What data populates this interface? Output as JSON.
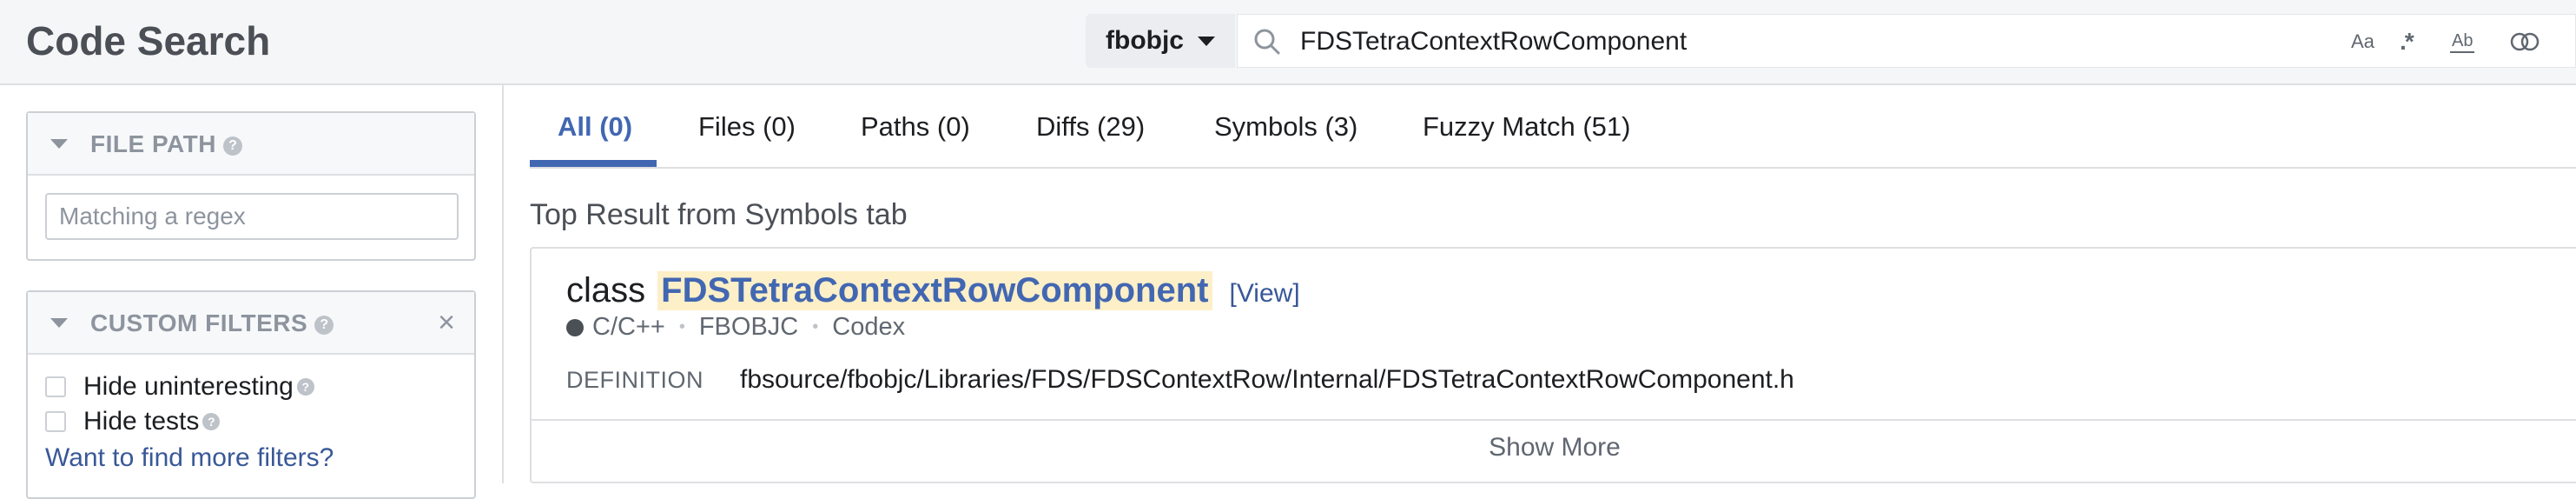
{
  "header": {
    "title": "Code Search",
    "repo": "fbobjc",
    "query": "FDSTetraContextRowComponent",
    "options": {
      "case": "Aa",
      "regex": ".*",
      "whole_word": "Ab",
      "link": ""
    }
  },
  "sidebar": {
    "file_path": {
      "title": "FILE PATH",
      "placeholder": "Matching a regex"
    },
    "custom_filters": {
      "title": "CUSTOM FILTERS",
      "items": [
        {
          "label": "Hide uninteresting"
        },
        {
          "label": "Hide tests"
        }
      ],
      "more_link": "Want to find more filters?"
    }
  },
  "tabs": [
    {
      "label": "All (0)",
      "active": true
    },
    {
      "label": "Files (0)"
    },
    {
      "label": "Paths (0)"
    },
    {
      "label": "Diffs (29)"
    },
    {
      "label": "Symbols (3)"
    },
    {
      "label": "Fuzzy Match (51)"
    }
  ],
  "main": {
    "section_title": "Top Result from Symbols tab",
    "result": {
      "kind": "class",
      "name": "FDSTetraContextRowComponent",
      "view_label": "[View]",
      "language": "C/C++",
      "repo": "FBOBJC",
      "source": "Codex",
      "definition_label": "DEFINITION",
      "definition_path": "fbsource/fbobjc/Libraries/FDS/FDSContextRow/Internal/FDSTetraContextRowComponent.h",
      "show_more": "Show More"
    }
  },
  "colors": {
    "accent": "#4267b2",
    "highlight": "#fdefc7",
    "header_bg": "#f5f6f7"
  }
}
